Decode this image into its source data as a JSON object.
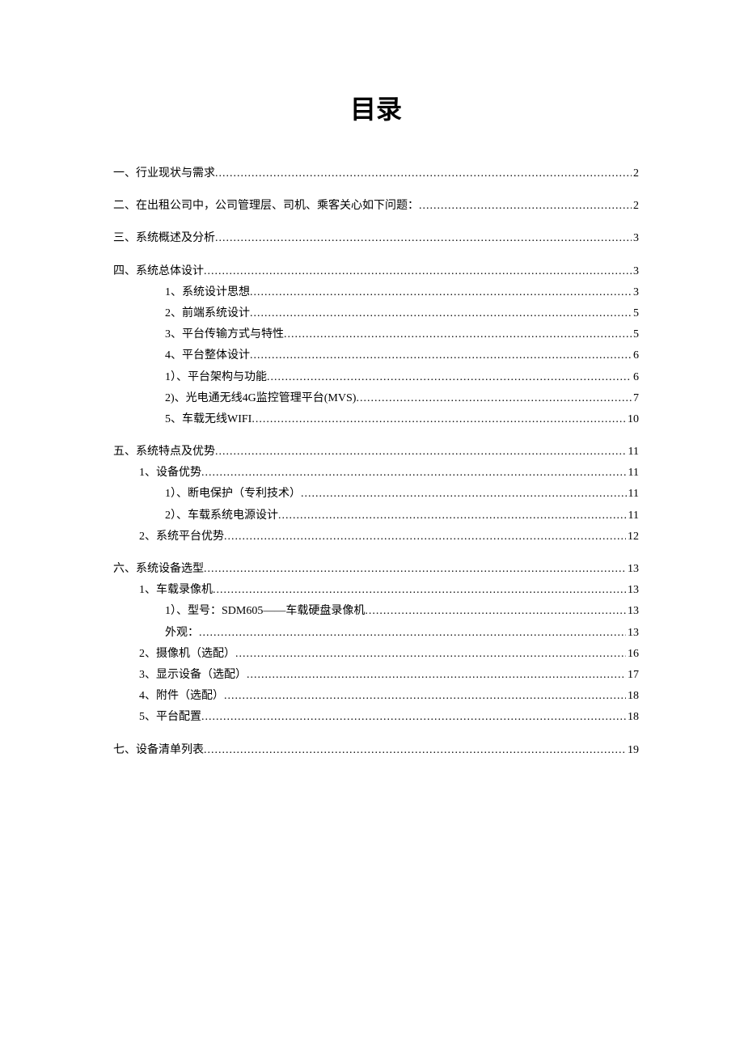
{
  "title": "目录",
  "entries": [
    {
      "level": 0,
      "label": "一、行业现状与需求",
      "page": "2"
    },
    {
      "level": 0,
      "label": "二、在出租公司中，公司管理层、司机、乘客关心如下问题：",
      "page": "2"
    },
    {
      "level": 0,
      "label": "三、系统概述及分析",
      "page": "3"
    },
    {
      "level": 0,
      "label": "四、系统总体设计",
      "page": "3"
    },
    {
      "level": 2,
      "label": "1、系统设计思想",
      "page": "3"
    },
    {
      "level": 2,
      "label": "2、前端系统设计",
      "page": "5"
    },
    {
      "level": 2,
      "label": "3、平台传输方式与特性",
      "page": "5"
    },
    {
      "level": 2,
      "label": "4、平台整体设计",
      "page": "6"
    },
    {
      "level": 2,
      "label": "1）、平台架构与功能",
      "page": "6"
    },
    {
      "level": 2,
      "label": "2)、光电通无线4G监控管理平台(MVS)",
      "page": "7"
    },
    {
      "level": 2,
      "label": "5、车载无线WIFI",
      "page": "10"
    },
    {
      "level": 0,
      "label": "五、系统特点及优势",
      "page": "11"
    },
    {
      "level": 1,
      "label": "1、设备优势",
      "page": "11"
    },
    {
      "level": 2,
      "label": "1）、断电保护（专利技术）",
      "page": "11"
    },
    {
      "level": 2,
      "label": "2）、车载系统电源设计",
      "page": "11"
    },
    {
      "level": 1,
      "label": "2、系统平台优势",
      "page": "12"
    },
    {
      "level": 0,
      "label": "六、系统设备选型",
      "page": "13"
    },
    {
      "level": 1,
      "label": "1、车载录像机",
      "page": "13"
    },
    {
      "level": 2,
      "label": "1）、型号：SDM605——车载硬盘录像机",
      "page": "13"
    },
    {
      "level": 2,
      "label": "外观：",
      "page": "13"
    },
    {
      "level": 1,
      "label": "2、摄像机（选配）",
      "page": "16"
    },
    {
      "level": 1,
      "label": "3、显示设备（选配）",
      "page": "17"
    },
    {
      "level": 1,
      "label": "4、附件（选配）",
      "page": "18"
    },
    {
      "level": 1,
      "label": "5、平台配置",
      "page": "18"
    },
    {
      "level": 0,
      "label": "七、设备清单列表",
      "page": "19"
    }
  ]
}
